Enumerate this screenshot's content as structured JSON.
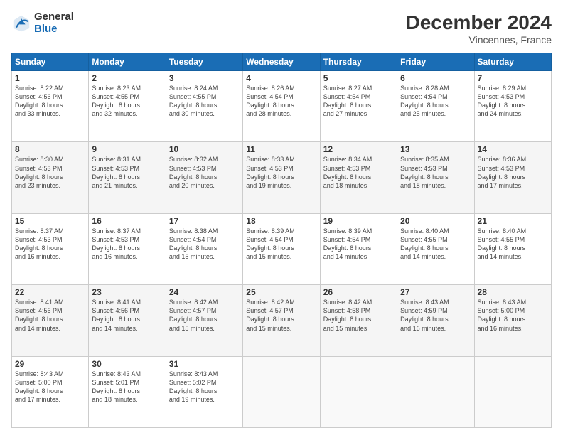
{
  "logo": {
    "general": "General",
    "blue": "Blue"
  },
  "header": {
    "title": "December 2024",
    "subtitle": "Vincennes, France"
  },
  "days_of_week": [
    "Sunday",
    "Monday",
    "Tuesday",
    "Wednesday",
    "Thursday",
    "Friday",
    "Saturday"
  ],
  "weeks": [
    [
      {
        "day": "1",
        "info": "Sunrise: 8:22 AM\nSunset: 4:56 PM\nDaylight: 8 hours\nand 33 minutes."
      },
      {
        "day": "2",
        "info": "Sunrise: 8:23 AM\nSunset: 4:55 PM\nDaylight: 8 hours\nand 32 minutes."
      },
      {
        "day": "3",
        "info": "Sunrise: 8:24 AM\nSunset: 4:55 PM\nDaylight: 8 hours\nand 30 minutes."
      },
      {
        "day": "4",
        "info": "Sunrise: 8:26 AM\nSunset: 4:54 PM\nDaylight: 8 hours\nand 28 minutes."
      },
      {
        "day": "5",
        "info": "Sunrise: 8:27 AM\nSunset: 4:54 PM\nDaylight: 8 hours\nand 27 minutes."
      },
      {
        "day": "6",
        "info": "Sunrise: 8:28 AM\nSunset: 4:54 PM\nDaylight: 8 hours\nand 25 minutes."
      },
      {
        "day": "7",
        "info": "Sunrise: 8:29 AM\nSunset: 4:53 PM\nDaylight: 8 hours\nand 24 minutes."
      }
    ],
    [
      {
        "day": "8",
        "info": "Sunrise: 8:30 AM\nSunset: 4:53 PM\nDaylight: 8 hours\nand 23 minutes."
      },
      {
        "day": "9",
        "info": "Sunrise: 8:31 AM\nSunset: 4:53 PM\nDaylight: 8 hours\nand 21 minutes."
      },
      {
        "day": "10",
        "info": "Sunrise: 8:32 AM\nSunset: 4:53 PM\nDaylight: 8 hours\nand 20 minutes."
      },
      {
        "day": "11",
        "info": "Sunrise: 8:33 AM\nSunset: 4:53 PM\nDaylight: 8 hours\nand 19 minutes."
      },
      {
        "day": "12",
        "info": "Sunrise: 8:34 AM\nSunset: 4:53 PM\nDaylight: 8 hours\nand 18 minutes."
      },
      {
        "day": "13",
        "info": "Sunrise: 8:35 AM\nSunset: 4:53 PM\nDaylight: 8 hours\nand 18 minutes."
      },
      {
        "day": "14",
        "info": "Sunrise: 8:36 AM\nSunset: 4:53 PM\nDaylight: 8 hours\nand 17 minutes."
      }
    ],
    [
      {
        "day": "15",
        "info": "Sunrise: 8:37 AM\nSunset: 4:53 PM\nDaylight: 8 hours\nand 16 minutes."
      },
      {
        "day": "16",
        "info": "Sunrise: 8:37 AM\nSunset: 4:53 PM\nDaylight: 8 hours\nand 16 minutes."
      },
      {
        "day": "17",
        "info": "Sunrise: 8:38 AM\nSunset: 4:54 PM\nDaylight: 8 hours\nand 15 minutes."
      },
      {
        "day": "18",
        "info": "Sunrise: 8:39 AM\nSunset: 4:54 PM\nDaylight: 8 hours\nand 15 minutes."
      },
      {
        "day": "19",
        "info": "Sunrise: 8:39 AM\nSunset: 4:54 PM\nDaylight: 8 hours\nand 14 minutes."
      },
      {
        "day": "20",
        "info": "Sunrise: 8:40 AM\nSunset: 4:55 PM\nDaylight: 8 hours\nand 14 minutes."
      },
      {
        "day": "21",
        "info": "Sunrise: 8:40 AM\nSunset: 4:55 PM\nDaylight: 8 hours\nand 14 minutes."
      }
    ],
    [
      {
        "day": "22",
        "info": "Sunrise: 8:41 AM\nSunset: 4:56 PM\nDaylight: 8 hours\nand 14 minutes."
      },
      {
        "day": "23",
        "info": "Sunrise: 8:41 AM\nSunset: 4:56 PM\nDaylight: 8 hours\nand 14 minutes."
      },
      {
        "day": "24",
        "info": "Sunrise: 8:42 AM\nSunset: 4:57 PM\nDaylight: 8 hours\nand 15 minutes."
      },
      {
        "day": "25",
        "info": "Sunrise: 8:42 AM\nSunset: 4:57 PM\nDaylight: 8 hours\nand 15 minutes."
      },
      {
        "day": "26",
        "info": "Sunrise: 8:42 AM\nSunset: 4:58 PM\nDaylight: 8 hours\nand 15 minutes."
      },
      {
        "day": "27",
        "info": "Sunrise: 8:43 AM\nSunset: 4:59 PM\nDaylight: 8 hours\nand 16 minutes."
      },
      {
        "day": "28",
        "info": "Sunrise: 8:43 AM\nSunset: 5:00 PM\nDaylight: 8 hours\nand 16 minutes."
      }
    ],
    [
      {
        "day": "29",
        "info": "Sunrise: 8:43 AM\nSunset: 5:00 PM\nDaylight: 8 hours\nand 17 minutes."
      },
      {
        "day": "30",
        "info": "Sunrise: 8:43 AM\nSunset: 5:01 PM\nDaylight: 8 hours\nand 18 minutes."
      },
      {
        "day": "31",
        "info": "Sunrise: 8:43 AM\nSunset: 5:02 PM\nDaylight: 8 hours\nand 19 minutes."
      },
      {
        "day": "",
        "info": ""
      },
      {
        "day": "",
        "info": ""
      },
      {
        "day": "",
        "info": ""
      },
      {
        "day": "",
        "info": ""
      }
    ]
  ]
}
